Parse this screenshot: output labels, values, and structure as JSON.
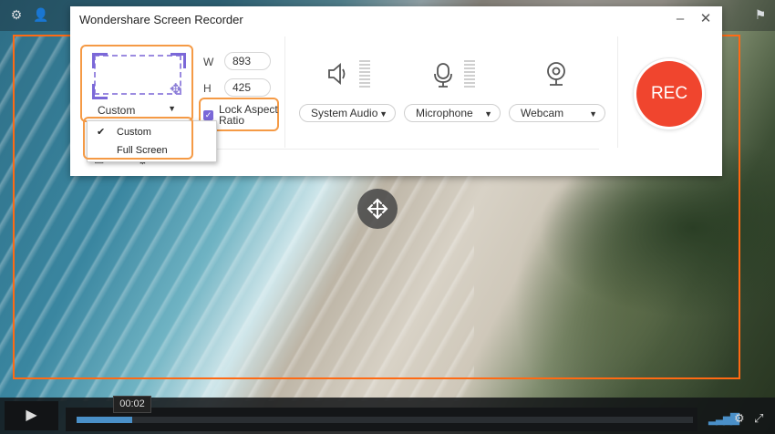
{
  "window": {
    "title": "Wondershare Screen Recorder"
  },
  "capture": {
    "mode_dropdown": "Custom",
    "width_label": "W",
    "width_value": "893",
    "height_label": "H",
    "height_value": "425",
    "lock_aspect_label": "Lock Aspect Ratio",
    "lock_aspect_checked": true,
    "mode_options": [
      "Custom",
      "Full Screen"
    ],
    "selected_option": "Custom"
  },
  "devices": {
    "system_audio": "System Audio",
    "microphone": "Microphone",
    "webcam": "Webcam"
  },
  "record": {
    "label": "REC"
  },
  "player": {
    "time": "00:02",
    "progress": 0.09
  },
  "colors": {
    "accent": "#7b68d8",
    "rec": "#f0452e",
    "highlight": "#f59a45",
    "frame": "#ff6a13",
    "progress": "#4a90c8"
  },
  "icons": [
    "settings-icon",
    "user-icon",
    "minimize-icon",
    "close-icon",
    "move-icon",
    "speaker-icon",
    "microphone-icon",
    "webcam-icon",
    "play-icon",
    "volume-icon",
    "gear-icon",
    "fullscreen-icon",
    "flag-icon"
  ]
}
